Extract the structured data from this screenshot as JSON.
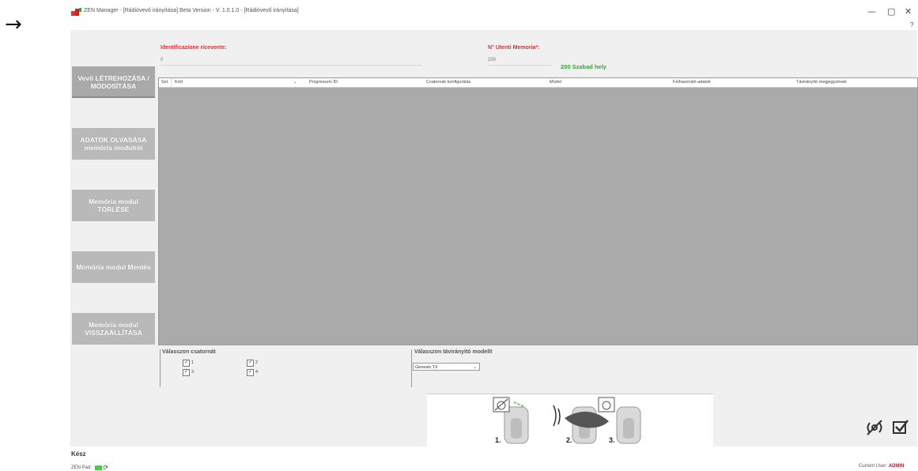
{
  "arrow": "→",
  "window": {
    "title": "ZEN Manager - [Rádióvevő irányítása] Beta Version - V. 1.0.1.0 - [Rádióvevő irányítása]",
    "minimize": "—",
    "restore": "▢",
    "close": "✕",
    "help": "?"
  },
  "sidebar": {
    "items": [
      {
        "label": "Vevő LÉTREHOZÁSA / MÓDOSÍTÁSA",
        "active": true
      },
      {
        "label": "ADATOK OLVASÁSA memória modulról",
        "active": false
      },
      {
        "label": "Memória modul TÖRLÉSE",
        "active": false
      },
      {
        "label": "Memória modul Mentés",
        "active": false
      },
      {
        "label": "Memória modul VISSZAÁLLÍTÁSA",
        "active": false
      }
    ]
  },
  "form": {
    "id_label": "Identificazione ricevente:",
    "id_value": "0",
    "users_label": "N° Utenti Memoria*:",
    "users_value": "200",
    "free_slots": "200 Szabad hely"
  },
  "grid": {
    "columns": [
      "Sel.",
      "Kód",
      "Progresszív ID",
      "Csatornák konfigurálás",
      "Model",
      "Felhasználó adatok",
      "Távirányító megjegyzések"
    ]
  },
  "channels": {
    "title": "Válasszon csatornát",
    "items": [
      {
        "label": "1",
        "checked": true
      },
      {
        "label": "2",
        "checked": true
      },
      {
        "label": "3",
        "checked": true
      },
      {
        "label": "4",
        "checked": true
      }
    ]
  },
  "model": {
    "title": "Válasszon távirányító modellt",
    "selected": "Genesis TX"
  },
  "illustration": {
    "steps": [
      "1.",
      "2.",
      "3."
    ]
  },
  "status": {
    "ready": "Kész",
    "zenpad_label": "ZEN Pad:",
    "user_label": "Current User:",
    "user_value": "ADMIN"
  },
  "colors": {
    "accent_red": "#e53030",
    "free_green": "#3aa335",
    "grid_gray": "#aaaaaa",
    "sidebar_gray": "#b9b9b9",
    "zenpad_green": "#3fd23f"
  }
}
